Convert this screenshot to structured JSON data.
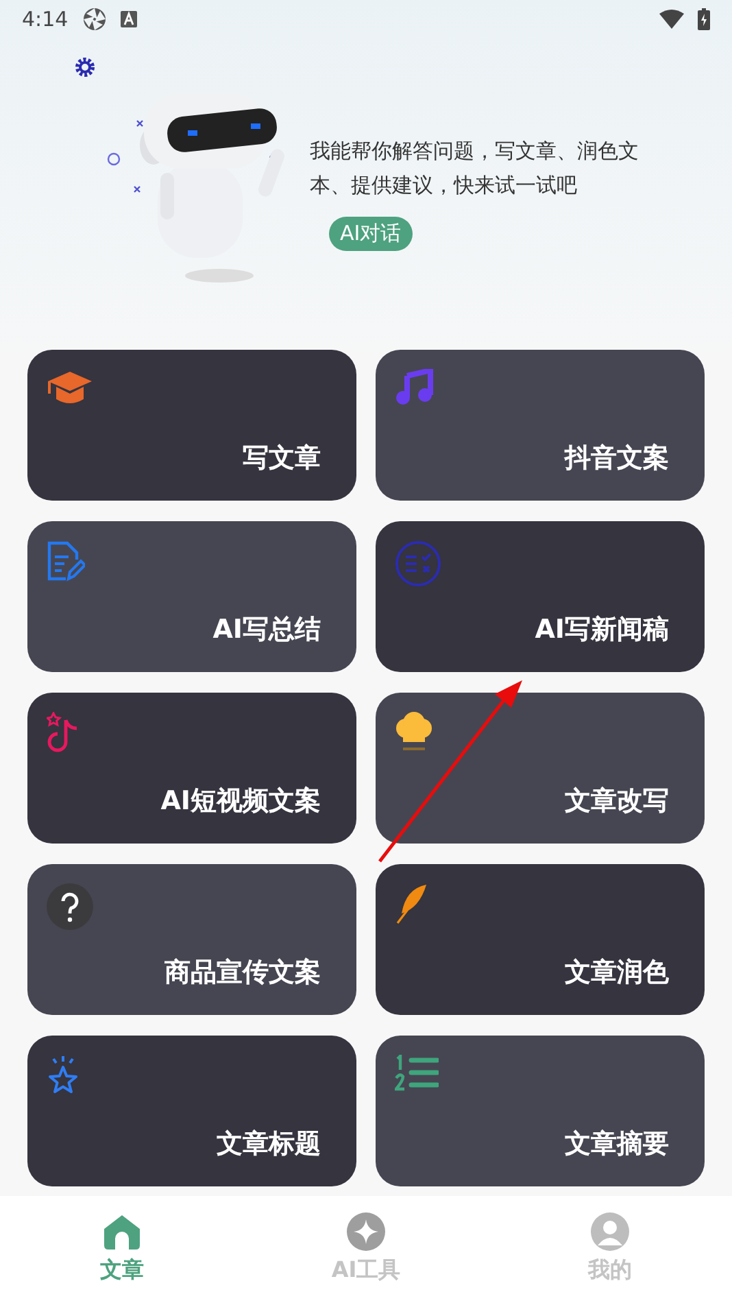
{
  "status_bar": {
    "time": "4:14"
  },
  "hero": {
    "message": "我能帮你解答问题，写文章、润色文本、提供建议，快来试一试吧",
    "chip": "AI对话"
  },
  "cards": [
    {
      "title": "写文章",
      "kind": "cap",
      "color": "#35343f"
    },
    {
      "title": "抖音文案",
      "kind": "note",
      "color": "#464652"
    },
    {
      "title": "AI写总结",
      "kind": "doc",
      "color": "#464652"
    },
    {
      "title": "AI写新闻稿",
      "kind": "checklist",
      "color": "#35343f"
    },
    {
      "title": "AI短视频文案",
      "kind": "tiktok",
      "color": "#35343f"
    },
    {
      "title": "文章改写",
      "kind": "chef",
      "color": "#464652"
    },
    {
      "title": "商品宣传文案",
      "kind": "question",
      "color": "#464652"
    },
    {
      "title": "文章润色",
      "kind": "feather",
      "color": "#35343f"
    },
    {
      "title": "文章标题",
      "kind": "star",
      "color": "#35343f"
    },
    {
      "title": "文章摘要",
      "kind": "numbered",
      "color": "#464652"
    }
  ],
  "nav": [
    {
      "label": "文章",
      "selected": true
    },
    {
      "label": "AI工具",
      "selected": false
    },
    {
      "label": "我的",
      "selected": false
    }
  ]
}
